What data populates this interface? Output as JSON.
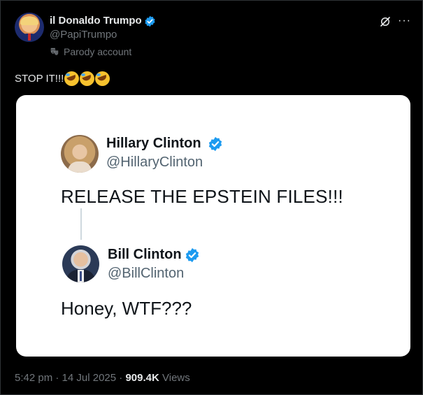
{
  "post": {
    "author": {
      "display_name": "il Donaldo Trumpo",
      "handle": "@PapiTrumpo",
      "label": "Parody account",
      "verified": true
    },
    "text": "STOP IT!!!",
    "emojis": [
      "rolling-on-floor-laughing",
      "rolling-on-floor-laughing",
      "rolling-on-floor-laughing"
    ],
    "meta": {
      "time": "5:42 pm",
      "sep1": "·",
      "date": "14 Jul 2025",
      "sep2": "·",
      "views_count": "909.4K",
      "views_label": "Views"
    }
  },
  "embedded": {
    "first": {
      "name": "Hillary Clinton",
      "handle": "@HillaryClinton",
      "text": "RELEASE THE EPSTEIN FILES!!!"
    },
    "second": {
      "name": "Bill Clinton",
      "handle": "@BillClinton",
      "text": "Honey, WTF???"
    }
  },
  "colors": {
    "background": "#000000",
    "verified_blue": "#1d9bf0",
    "muted": "#71767b",
    "card": "#ffffff"
  }
}
